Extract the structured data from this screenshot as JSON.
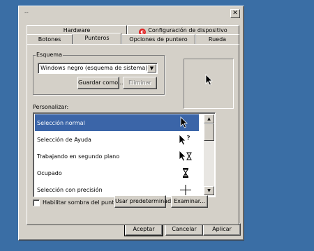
{
  "window": {
    "minimize_glyph": "--",
    "close_glyph": "✕"
  },
  "tabs": {
    "row_back": [
      {
        "label": "Hardware"
      },
      {
        "label": "Configuración de dispositivo",
        "icon": "device-config-icon"
      }
    ],
    "row_front": [
      {
        "label": "Botones"
      },
      {
        "label": "Punteros",
        "active": true
      },
      {
        "label": "Opciones de puntero"
      },
      {
        "label": "Rueda"
      }
    ]
  },
  "scheme": {
    "group_label": "Esquema",
    "selected": "Windows negro (esquema de sistema)",
    "save_as_label": "Guardar como...",
    "delete_label": "Eliminar"
  },
  "customize": {
    "label": "Personalizar:",
    "items": [
      {
        "label": "Selección normal",
        "icon": "normal-select-cursor-icon",
        "selected": true
      },
      {
        "label": "Selección de Ayuda",
        "icon": "help-select-cursor-icon"
      },
      {
        "label": "Trabajando en segundo plano",
        "icon": "working-in-background-cursor-icon"
      },
      {
        "label": "Ocupado",
        "icon": "busy-hourglass-cursor-icon"
      },
      {
        "label": "Selección con precisión",
        "icon": "precision-crosshair-cursor-icon"
      }
    ]
  },
  "shadow_checkbox": {
    "label": "Habilitar sombra del puntero",
    "checked": false
  },
  "use_default_label": "Usar predeterminado",
  "browse_label": "Examinar...",
  "footer": {
    "ok_label": "Aceptar",
    "cancel_label": "Cancelar",
    "apply_label": "Aplicar"
  },
  "colors": {
    "desktop": "#3a6ea5",
    "dialog": "#d4d0c8",
    "selection": "#3b65a8"
  }
}
